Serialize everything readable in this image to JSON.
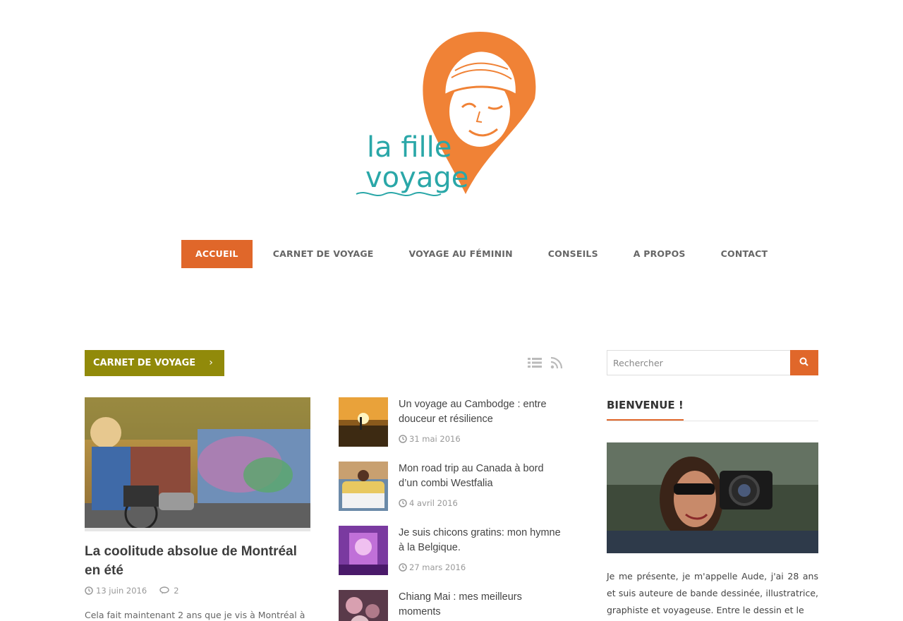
{
  "logo": {
    "line1": "la fille",
    "line2": "voyage",
    "accent": "#f08236",
    "teal": "#2aa7a8"
  },
  "nav": {
    "items": [
      {
        "label": "ACCUEIL",
        "active": true
      },
      {
        "label": "CARNET DE VOYAGE"
      },
      {
        "label": "VOYAGE AU FÉMININ"
      },
      {
        "label": "CONSEILS"
      },
      {
        "label": "A PROPOS"
      },
      {
        "label": "CONTACT"
      }
    ],
    "active_color": "#e0672a"
  },
  "section": {
    "category": "CARNET DE VOYAGE",
    "chevron": "›",
    "category_color": "#918a0a",
    "icons": [
      "list-icon",
      "rss-icon"
    ]
  },
  "featured": {
    "title": "La coolitude absolue de Montréal en été",
    "date": "13 juin 2016",
    "comments": "2",
    "excerpt": "Cela fait maintenant 2 ans que je vis à Montréal à"
  },
  "posts": [
    {
      "title": "Un voyage au Cambodge : entre douceur et résilience",
      "date": "31 mai 2016"
    },
    {
      "title": "Mon road trip au Canada à bord d’un combi Westfalia",
      "date": "4 avril 2016"
    },
    {
      "title": "Je suis chicons gratins: mon hymne à la Belgique.",
      "date": "27 mars 2016"
    },
    {
      "title": "Chiang Mai : mes meilleurs moments",
      "date": ""
    }
  ],
  "sidebar": {
    "search_placeholder": "Rechercher",
    "widget_title": "BIENVENUE !",
    "about_text": "Je me présente, je m'appelle Aude, j'ai 28 ans et suis auteure de bande dessinée, illustratrice, graphiste et voyageuse. Entre le dessin et le"
  }
}
